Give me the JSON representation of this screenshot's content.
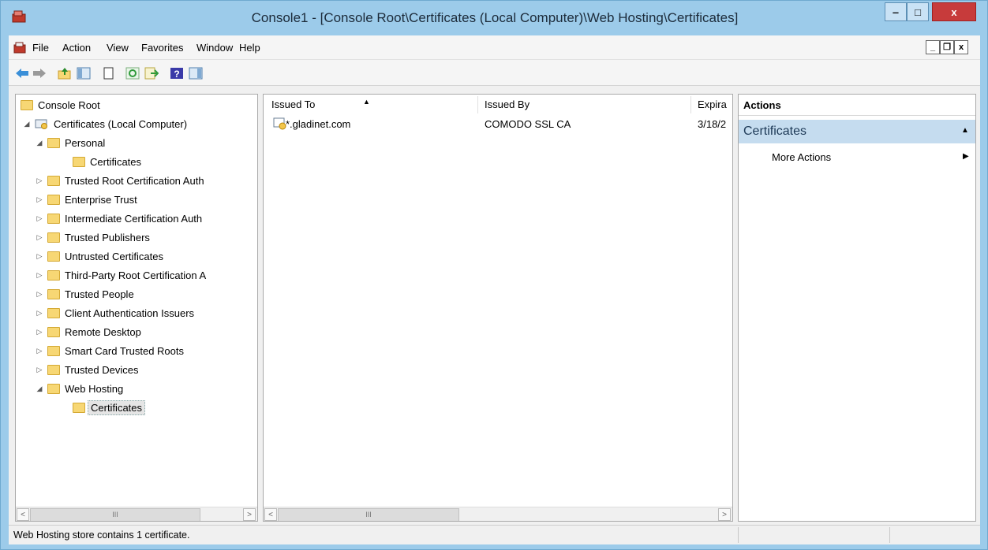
{
  "window": {
    "title": "Console1 - [Console Root\\Certificates (Local Computer)\\Web Hosting\\Certificates]",
    "minimize_glyph": "‒",
    "maximize_glyph": "□",
    "close_glyph": "x"
  },
  "menu": {
    "items": [
      "File",
      "Action",
      "View",
      "Favorites",
      "Window",
      "Help"
    ],
    "mdi_minimize": "_",
    "mdi_restore": "❐",
    "mdi_close": "x"
  },
  "toolbar": {
    "buttons": [
      "back-icon",
      "forward-icon",
      "up-one-level-icon",
      "show-hide-console-tree-icon",
      "properties-icon",
      "refresh-icon",
      "export-list-icon",
      "help-icon",
      "show-hide-action-pane-icon"
    ]
  },
  "tree": {
    "root": "Console Root",
    "computer": "Certificates (Local Computer)",
    "items": [
      "Personal",
      "Certificates",
      "Trusted Root Certification Auth",
      "Enterprise Trust",
      "Intermediate Certification Auth",
      "Trusted Publishers",
      "Untrusted Certificates",
      "Third-Party Root Certification A",
      "Trusted People",
      "Client Authentication Issuers",
      "Remote Desktop",
      "Smart Card Trusted Roots",
      "Trusted Devices",
      "Web Hosting",
      "Certificates"
    ],
    "scroll_thumb": "III"
  },
  "list": {
    "columns": [
      "Issued To",
      "Issued By",
      "Expira"
    ],
    "sort_glyph": "▲",
    "rows": [
      {
        "issued_to": "*.gladinet.com",
        "issued_by": "COMODO SSL CA",
        "expiration": "3/18/2"
      }
    ],
    "scroll_thumb": "III"
  },
  "actions": {
    "header": "Actions",
    "section": "Certificates",
    "section_glyph": "▲",
    "more": "More Actions",
    "more_glyph": "▶"
  },
  "status": {
    "text": "Web Hosting store contains 1 certificate."
  },
  "colors": {
    "accent": "#c5dcef",
    "close": "#c73b3b",
    "folder": "#f7d774"
  }
}
